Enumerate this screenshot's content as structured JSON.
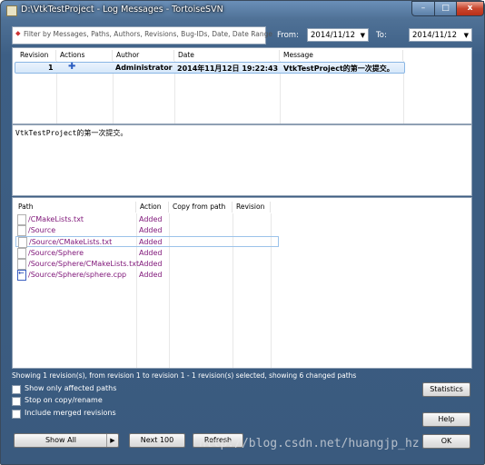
{
  "window": {
    "title": "D:\\VtkTestProject - Log Messages - TortoiseSVN",
    "controls": {
      "minimize": "–",
      "maximize": "□",
      "close": "x"
    }
  },
  "filter": {
    "placeholder": "Filter by Messages, Paths, Authors, Revisions, Bug-IDs, Date, Date Range",
    "from_label": "From:",
    "from_value": "2014/11/12",
    "to_label": "To:",
    "to_value": "2014/11/12"
  },
  "log_table": {
    "headers": [
      "Revision",
      "Actions",
      "Author",
      "Date",
      "Message"
    ],
    "rows": [
      {
        "revision": "1",
        "action_icon": "add-plus-icon",
        "author": "Administrator",
        "date": "2014年11月12日 19:22:43",
        "message": "VtkTestProject的第一次提交。"
      }
    ]
  },
  "message_pane": {
    "text": "VtkTestProject的第一次提交。"
  },
  "paths_table": {
    "headers": [
      "Path",
      "Action",
      "Copy from path",
      "Revision"
    ],
    "rows": [
      {
        "path": "/CMakeLists.txt",
        "action": "Added",
        "icon": "file-icon"
      },
      {
        "path": "/Source",
        "action": "Added",
        "icon": "file-icon"
      },
      {
        "path": "/Source/CMakeLists.txt",
        "action": "Added",
        "icon": "file-icon"
      },
      {
        "path": "/Source/Sphere",
        "action": "Added",
        "icon": "file-icon"
      },
      {
        "path": "/Source/Sphere/CMakeLists.txt",
        "action": "Added",
        "icon": "file-icon"
      },
      {
        "path": "/Source/Sphere/sphere.cpp",
        "action": "Added",
        "icon": "modified-file-icon"
      }
    ]
  },
  "status": "Showing 1 revision(s), from revision 1 to revision 1 - 1 revision(s) selected, showing 6 changed paths",
  "options": [
    {
      "label": "Show only affected paths",
      "checked": false
    },
    {
      "label": "Stop on copy/rename",
      "checked": false
    },
    {
      "label": "Include merged revisions",
      "checked": false
    }
  ],
  "buttons": {
    "show_all": "Show All",
    "next_100": "Next 100",
    "refresh": "Refresh",
    "statistics": "Statistics",
    "help": "Help",
    "ok": "OK"
  },
  "watermark": "http://blog.csdn.net/huangjp_hz"
}
